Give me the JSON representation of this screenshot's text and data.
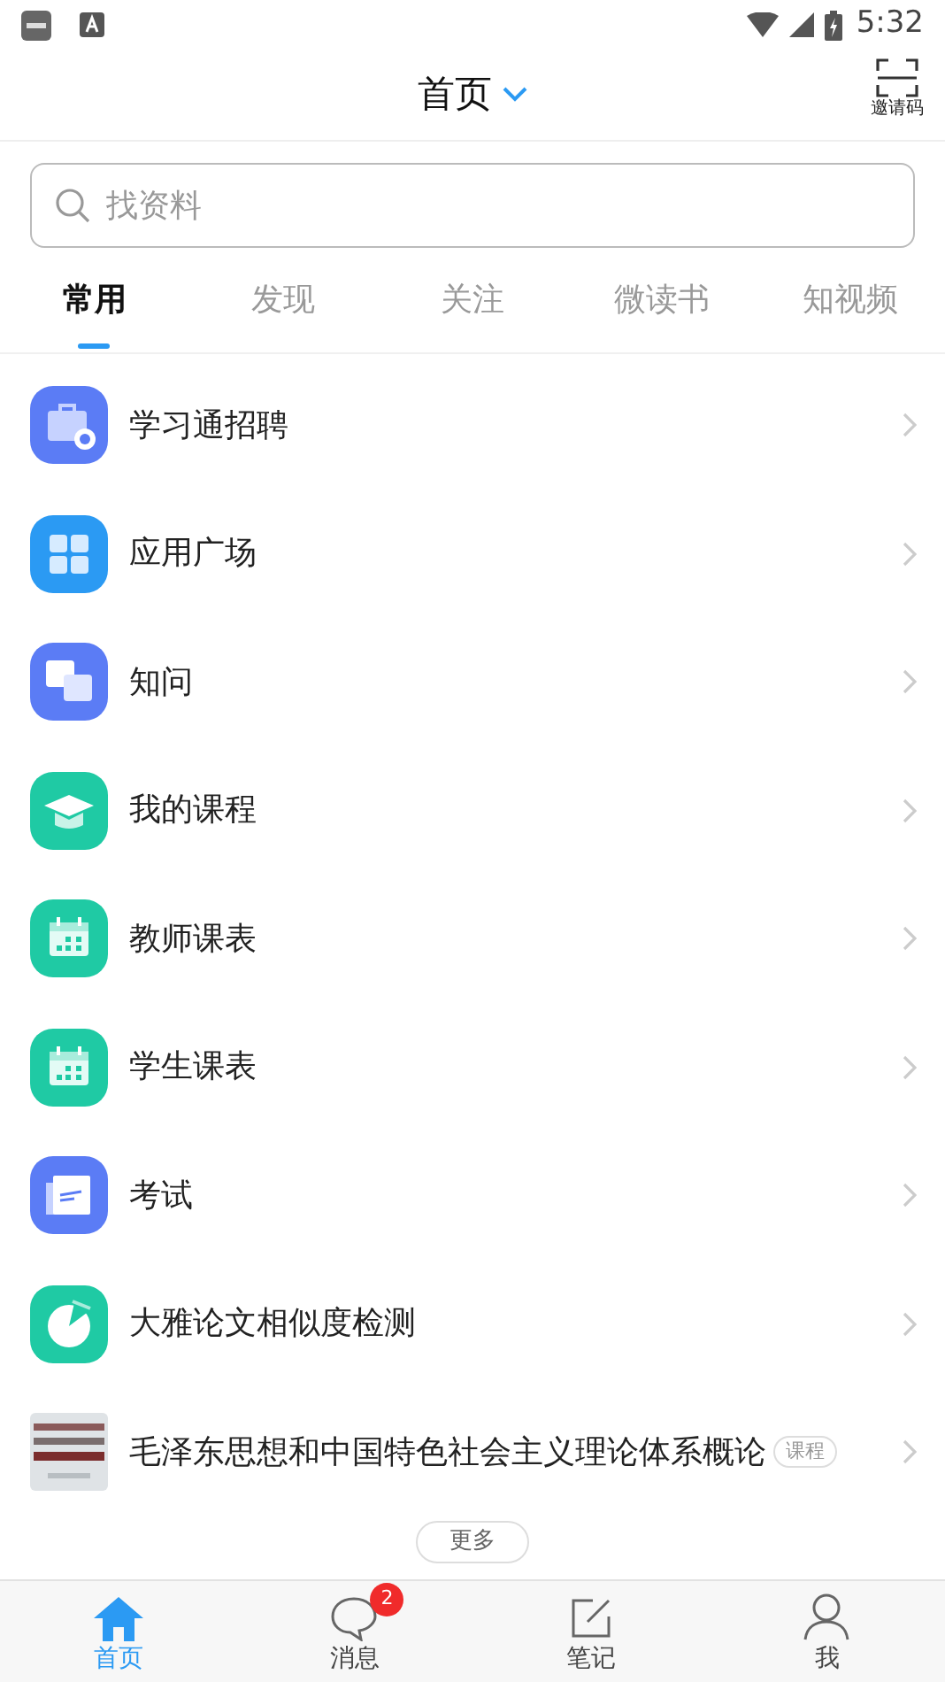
{
  "status_bar": {
    "time": "5:32"
  },
  "header": {
    "title": "首页",
    "scan_label": "邀请码"
  },
  "search": {
    "placeholder": "找资料"
  },
  "tabs": [
    {
      "label": "常用",
      "selected": true
    },
    {
      "label": "发现",
      "selected": false
    },
    {
      "label": "关注",
      "selected": false
    },
    {
      "label": "微读书",
      "selected": false
    },
    {
      "label": "知视频",
      "selected": false
    }
  ],
  "items": [
    {
      "kind": "app",
      "label": "学习通招聘"
    },
    {
      "kind": "app",
      "label": "应用广场"
    },
    {
      "kind": "app",
      "label": "知问"
    },
    {
      "kind": "app",
      "label": "我的课程"
    },
    {
      "kind": "app",
      "label": "教师课表"
    },
    {
      "kind": "app",
      "label": "学生课表"
    },
    {
      "kind": "app",
      "label": "考试"
    },
    {
      "kind": "app",
      "label": "大雅论文相似度检测"
    },
    {
      "kind": "course",
      "label": "毛泽东思想和中国特色社会主义理论体系概论",
      "tag": "课程"
    }
  ],
  "more_button": "更多",
  "bottom_nav": [
    {
      "label": "首页",
      "selected": true
    },
    {
      "label": "消息",
      "selected": false,
      "badge": "2"
    },
    {
      "label": "笔记",
      "selected": false
    },
    {
      "label": "我",
      "selected": false
    }
  ]
}
